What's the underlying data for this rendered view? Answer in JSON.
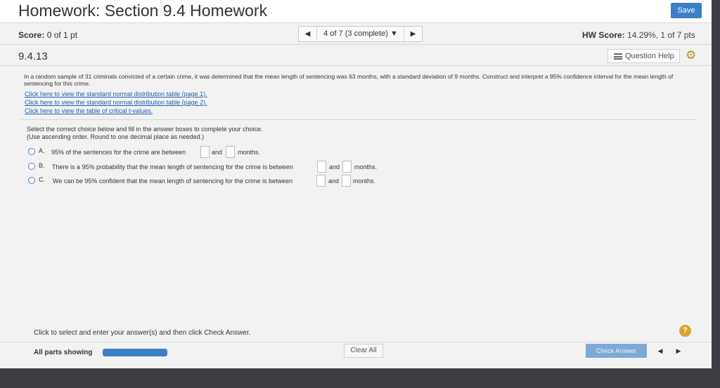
{
  "header": {
    "title": "Homework: Section 9.4 Homework",
    "save_label": "Save"
  },
  "scorebar": {
    "score_label": "Score:",
    "score_value": "0 of 1 pt",
    "prev_icon": "◀",
    "position": "4 of 7 (3 complete) ▼",
    "next_icon": "▶",
    "hw_score_label": "HW Score:",
    "hw_score_value": "14.29%, 1 of 7 pts"
  },
  "question": {
    "number": "9.4.13",
    "help_label": "Question Help",
    "problem_text": "In a random sample of 31 criminals convicted of a certain crime, it was determined that the mean length of sentencing was 63 months, with a standard deviation of 9 months. Construct and interpret a 95% confidence interval for the mean length of sentencing for this crime.",
    "links": [
      "Click here to view the standard normal distribution table (page 1).",
      "Click here to view the standard normal distribution table (page 2).",
      "Click here to view the table of critical t-values."
    ],
    "instruction_1": "Select the correct choice below and fill in the answer boxes to complete your choice.",
    "instruction_2": "(Use ascending order. Round to one decimal place as needed.)",
    "choices": [
      {
        "label": "A.",
        "pre": "95% of the sentences for the crime are between",
        "mid": "and",
        "post": "months."
      },
      {
        "label": "B.",
        "pre": "There is a 95% probability that the mean length of sentencing for the crime is between",
        "mid": "and",
        "post": "months."
      },
      {
        "label": "C.",
        "pre": "We can be 95% confident that the mean length of sentencing for the crime is between",
        "mid": "and",
        "post": "months."
      }
    ]
  },
  "bottom": {
    "note": "Click to select and enter your answer(s) and then click Check Answer.",
    "help_icon": "?",
    "all_parts": "All parts showing",
    "progress_fraction": 1.0,
    "clear_label": "Clear All",
    "check_label": "Check Answer",
    "nav_prev": "◀",
    "nav_next": "▶"
  },
  "colors": {
    "accent": "#3d7fc6",
    "link": "#1f5fae",
    "help": "#d9a42a"
  }
}
